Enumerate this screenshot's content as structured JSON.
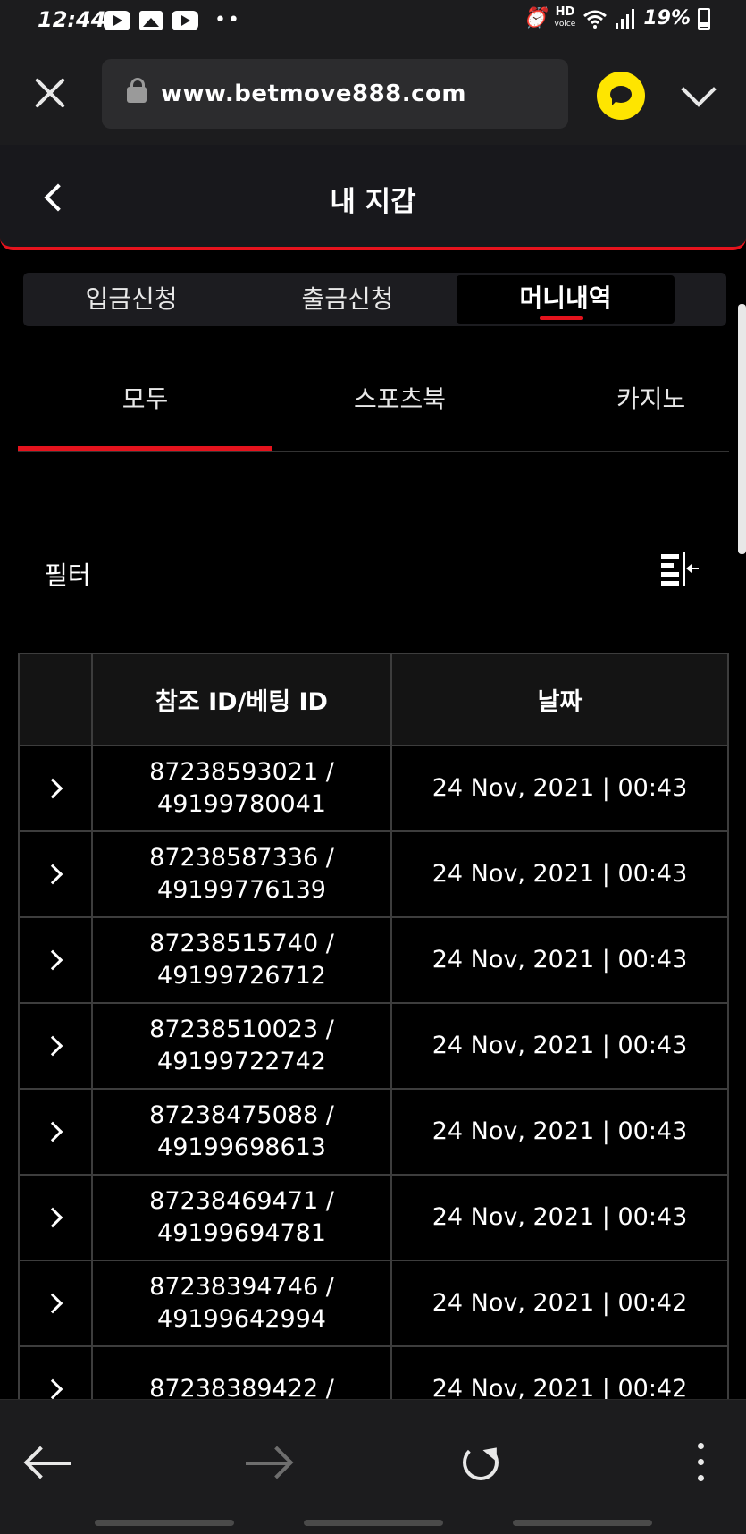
{
  "status_bar": {
    "time": "12:44",
    "hd_top": "HD",
    "hd_bottom": "voice",
    "battery": "19%"
  },
  "browser": {
    "url": "www.betmove888.com"
  },
  "header": {
    "title": "내 지갑"
  },
  "segment_tabs": [
    {
      "label": "입금신청"
    },
    {
      "label": "출금신청"
    },
    {
      "label": "머니내역"
    }
  ],
  "category_tabs": [
    {
      "label": "모두"
    },
    {
      "label": "스포츠북"
    },
    {
      "label": "카지노"
    }
  ],
  "filter": {
    "label": "필터"
  },
  "table": {
    "headers": [
      "참조 ID/베팅 ID",
      "날짜"
    ],
    "rows": [
      {
        "ref_id": "87238593021 /",
        "bet_id": "49199780041",
        "date": "24 Nov, 2021 | 00:43"
      },
      {
        "ref_id": "87238587336 /",
        "bet_id": "49199776139",
        "date": "24 Nov, 2021 | 00:43"
      },
      {
        "ref_id": "87238515740 /",
        "bet_id": "49199726712",
        "date": "24 Nov, 2021 | 00:43"
      },
      {
        "ref_id": "87238510023 /",
        "bet_id": "49199722742",
        "date": "24 Nov, 2021 | 00:43"
      },
      {
        "ref_id": "87238475088 /",
        "bet_id": "49199698613",
        "date": "24 Nov, 2021 | 00:43"
      },
      {
        "ref_id": "87238469471 /",
        "bet_id": "49199694781",
        "date": "24 Nov, 2021 | 00:43"
      },
      {
        "ref_id": "87238394746 /",
        "bet_id": "49199642994",
        "date": "24 Nov, 2021 | 00:42"
      },
      {
        "ref_id": "87238389422 /",
        "bet_id": "",
        "date": "24 Nov, 2021 | 00:42"
      }
    ]
  },
  "colors": {
    "accent": "#e5131d",
    "background": "#000000",
    "bar": "#1c1c1e",
    "kakao": "#fee500"
  }
}
